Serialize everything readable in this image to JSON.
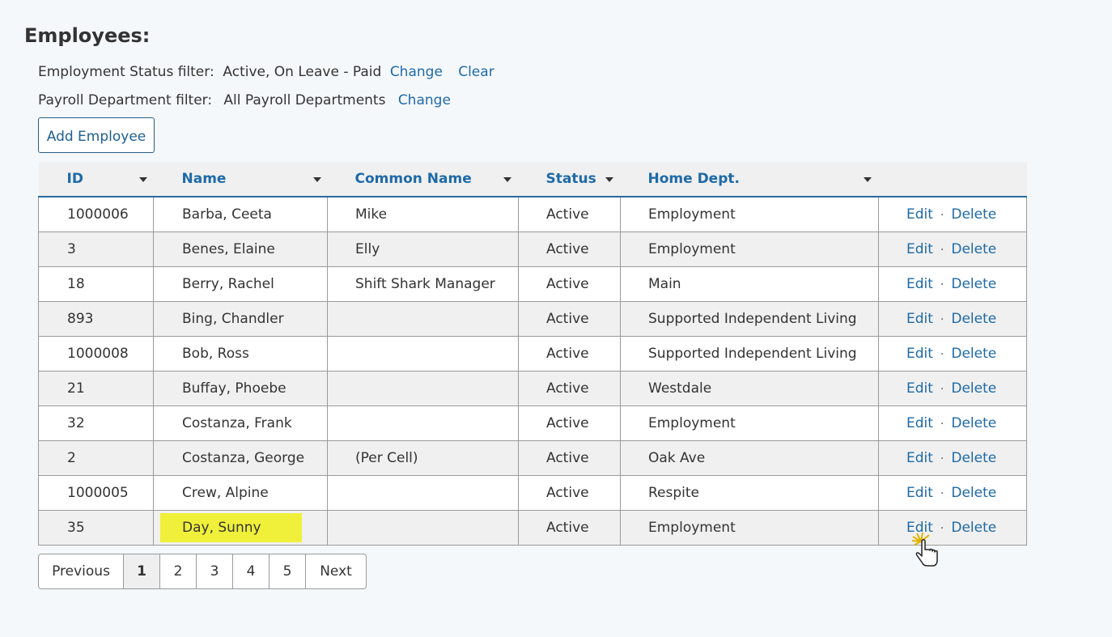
{
  "title": "Employees:",
  "filters": {
    "status_label": "Employment Status filter:",
    "status_value": "Active, On Leave - Paid",
    "status_change": "Change",
    "status_clear": "Clear",
    "dept_label": "Payroll Department filter:",
    "dept_value": "All Payroll Departments",
    "dept_change": "Change"
  },
  "add_button": "Add Employee",
  "table": {
    "headers": [
      "ID",
      "Name",
      "Common Name",
      "Status",
      "Home Dept."
    ],
    "rows": [
      {
        "id": "1000006",
        "name": "Barba, Ceeta",
        "common": "Mike",
        "status": "Active",
        "dept": "Employment"
      },
      {
        "id": "3",
        "name": "Benes, Elaine",
        "common": "Elly",
        "status": "Active",
        "dept": "Employment"
      },
      {
        "id": "18",
        "name": "Berry, Rachel",
        "common": "Shift Shark Manager",
        "status": "Active",
        "dept": "Main"
      },
      {
        "id": "893",
        "name": "Bing, Chandler",
        "common": "",
        "status": "Active",
        "dept": "Supported Independent Living"
      },
      {
        "id": "1000008",
        "name": "Bob, Ross",
        "common": "",
        "status": "Active",
        "dept": "Supported Independent Living"
      },
      {
        "id": "21",
        "name": "Buffay, Phoebe",
        "common": "",
        "status": "Active",
        "dept": "Westdale"
      },
      {
        "id": "32",
        "name": "Costanza, Frank",
        "common": "",
        "status": "Active",
        "dept": "Employment"
      },
      {
        "id": "2",
        "name": "Costanza, George",
        "common": "(Per Cell)",
        "status": "Active",
        "dept": "Oak Ave"
      },
      {
        "id": "1000005",
        "name": "Crew, Alpine",
        "common": "",
        "status": "Active",
        "dept": "Respite"
      },
      {
        "id": "35",
        "name": "Day, Sunny",
        "common": "",
        "status": "Active",
        "dept": "Employment"
      }
    ],
    "edit_label": "Edit",
    "separator": "·",
    "delete_label": "Delete"
  },
  "pager": {
    "previous": "Previous",
    "pages": [
      "1",
      "2",
      "3",
      "4",
      "5"
    ],
    "current": "1",
    "next": "Next"
  },
  "colors": {
    "link": "#1e6aa8",
    "highlight": "#f0f03a"
  }
}
